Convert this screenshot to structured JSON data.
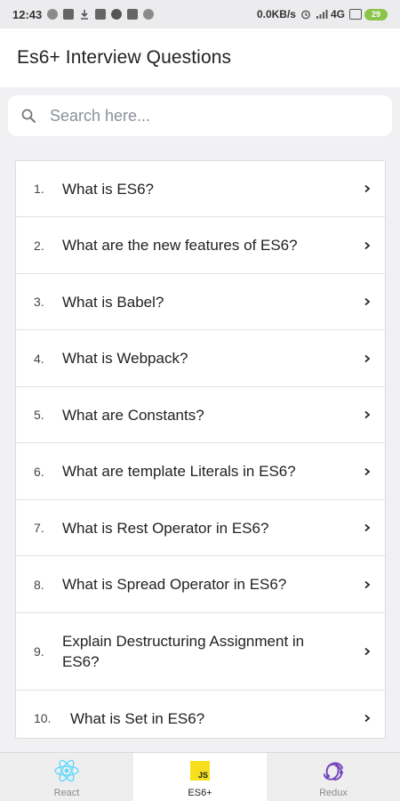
{
  "status_bar": {
    "time": "12:43",
    "network_speed": "0.0KB/s",
    "signal": "4G",
    "battery": "29"
  },
  "app_bar": {
    "title": "Es6+ Interview Questions"
  },
  "search": {
    "placeholder": "Search here..."
  },
  "questions": [
    {
      "num": "1.",
      "text": "What is ES6?"
    },
    {
      "num": "2.",
      "text": "What are the new features of ES6?"
    },
    {
      "num": "3.",
      "text": "What is Babel?"
    },
    {
      "num": "4.",
      "text": "What is Webpack?"
    },
    {
      "num": "5.",
      "text": "What are Constants?"
    },
    {
      "num": "6.",
      "text": "What are template Literals in ES6?"
    },
    {
      "num": "7.",
      "text": "What is Rest Operator in ES6?"
    },
    {
      "num": "8.",
      "text": "What is Spread Operator in ES6?"
    },
    {
      "num": "9.",
      "text": "Explain Destructuring Assignment in ES6?"
    },
    {
      "num": "10.",
      "text": "What is Set in ES6?"
    }
  ],
  "bottom_nav": {
    "tabs": [
      {
        "label": "React",
        "icon": "react-icon",
        "active": false
      },
      {
        "label": "ES6+",
        "icon": "js-icon",
        "active": true,
        "badge_text": "JS"
      },
      {
        "label": "Redux",
        "icon": "redux-icon",
        "active": false
      }
    ]
  },
  "colors": {
    "react": "#61dafb",
    "js": "#f7df1e",
    "redux": "#764abc",
    "battery": "#8bc34a"
  }
}
